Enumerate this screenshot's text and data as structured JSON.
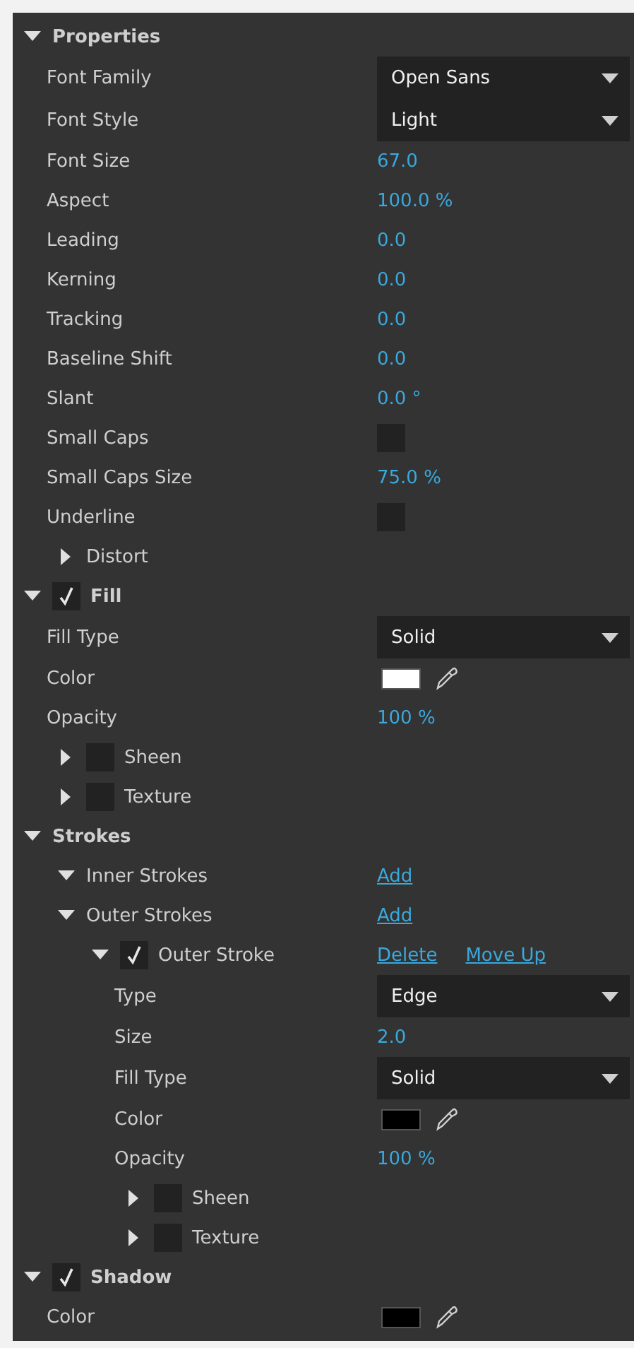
{
  "panel": {
    "items": [
      {
        "kind": "group",
        "label": "Properties",
        "expanded": true,
        "children": [
          {
            "kind": "dropdown",
            "label": "Font Family",
            "value": "Open Sans"
          },
          {
            "kind": "dropdown",
            "label": "Font Style",
            "value": "Light"
          },
          {
            "kind": "number",
            "label": "Font Size",
            "value": "67.0"
          },
          {
            "kind": "number",
            "label": "Aspect",
            "value": "100.0 %"
          },
          {
            "kind": "number",
            "label": "Leading",
            "value": "0.0"
          },
          {
            "kind": "number",
            "label": "Kerning",
            "value": "0.0"
          },
          {
            "kind": "number",
            "label": "Tracking",
            "value": "0.0"
          },
          {
            "kind": "number",
            "label": "Baseline Shift",
            "value": "0.0"
          },
          {
            "kind": "number",
            "label": "Slant",
            "value": "0.0 °"
          },
          {
            "kind": "checkbox",
            "label": "Small Caps",
            "checked": false
          },
          {
            "kind": "number",
            "label": "Small Caps Size",
            "value": "75.0 %"
          },
          {
            "kind": "checkbox",
            "label": "Underline",
            "checked": false
          },
          {
            "kind": "group",
            "label": "Distort",
            "expanded": false
          }
        ]
      },
      {
        "kind": "group",
        "label": "Fill",
        "checked": true,
        "expanded": true,
        "children": [
          {
            "kind": "dropdown",
            "label": "Fill Type",
            "value": "Solid"
          },
          {
            "kind": "color",
            "label": "Color",
            "color": "#ffffff"
          },
          {
            "kind": "number",
            "label": "Opacity",
            "value": "100 %"
          },
          {
            "kind": "group",
            "label": "Sheen",
            "checked": false,
            "expanded": false
          },
          {
            "kind": "group",
            "label": "Texture",
            "checked": false,
            "expanded": false
          }
        ]
      },
      {
        "kind": "group",
        "label": "Strokes",
        "expanded": true,
        "children": [
          {
            "kind": "group",
            "label": "Inner Strokes",
            "expanded": true,
            "links": [
              "Add"
            ]
          },
          {
            "kind": "group",
            "label": "Outer Strokes",
            "expanded": true,
            "links": [
              "Add"
            ],
            "children": [
              {
                "kind": "group",
                "label": "Outer Stroke",
                "checked": true,
                "expanded": true,
                "links": [
                  "Delete",
                  "Move Up"
                ],
                "children": [
                  {
                    "kind": "dropdown",
                    "label": "Type",
                    "value": "Edge"
                  },
                  {
                    "kind": "number",
                    "label": "Size",
                    "value": "2.0"
                  },
                  {
                    "kind": "dropdown",
                    "label": "Fill Type",
                    "value": "Solid"
                  },
                  {
                    "kind": "color",
                    "label": "Color",
                    "color": "#000000"
                  },
                  {
                    "kind": "number",
                    "label": "Opacity",
                    "value": "100 %"
                  },
                  {
                    "kind": "group",
                    "label": "Sheen",
                    "checked": false,
                    "expanded": false
                  },
                  {
                    "kind": "group",
                    "label": "Texture",
                    "checked": false,
                    "expanded": false
                  }
                ]
              }
            ]
          }
        ]
      },
      {
        "kind": "group",
        "label": "Shadow",
        "checked": true,
        "expanded": true,
        "children": [
          {
            "kind": "color",
            "label": "Color",
            "color": "#000000"
          }
        ]
      }
    ]
  }
}
